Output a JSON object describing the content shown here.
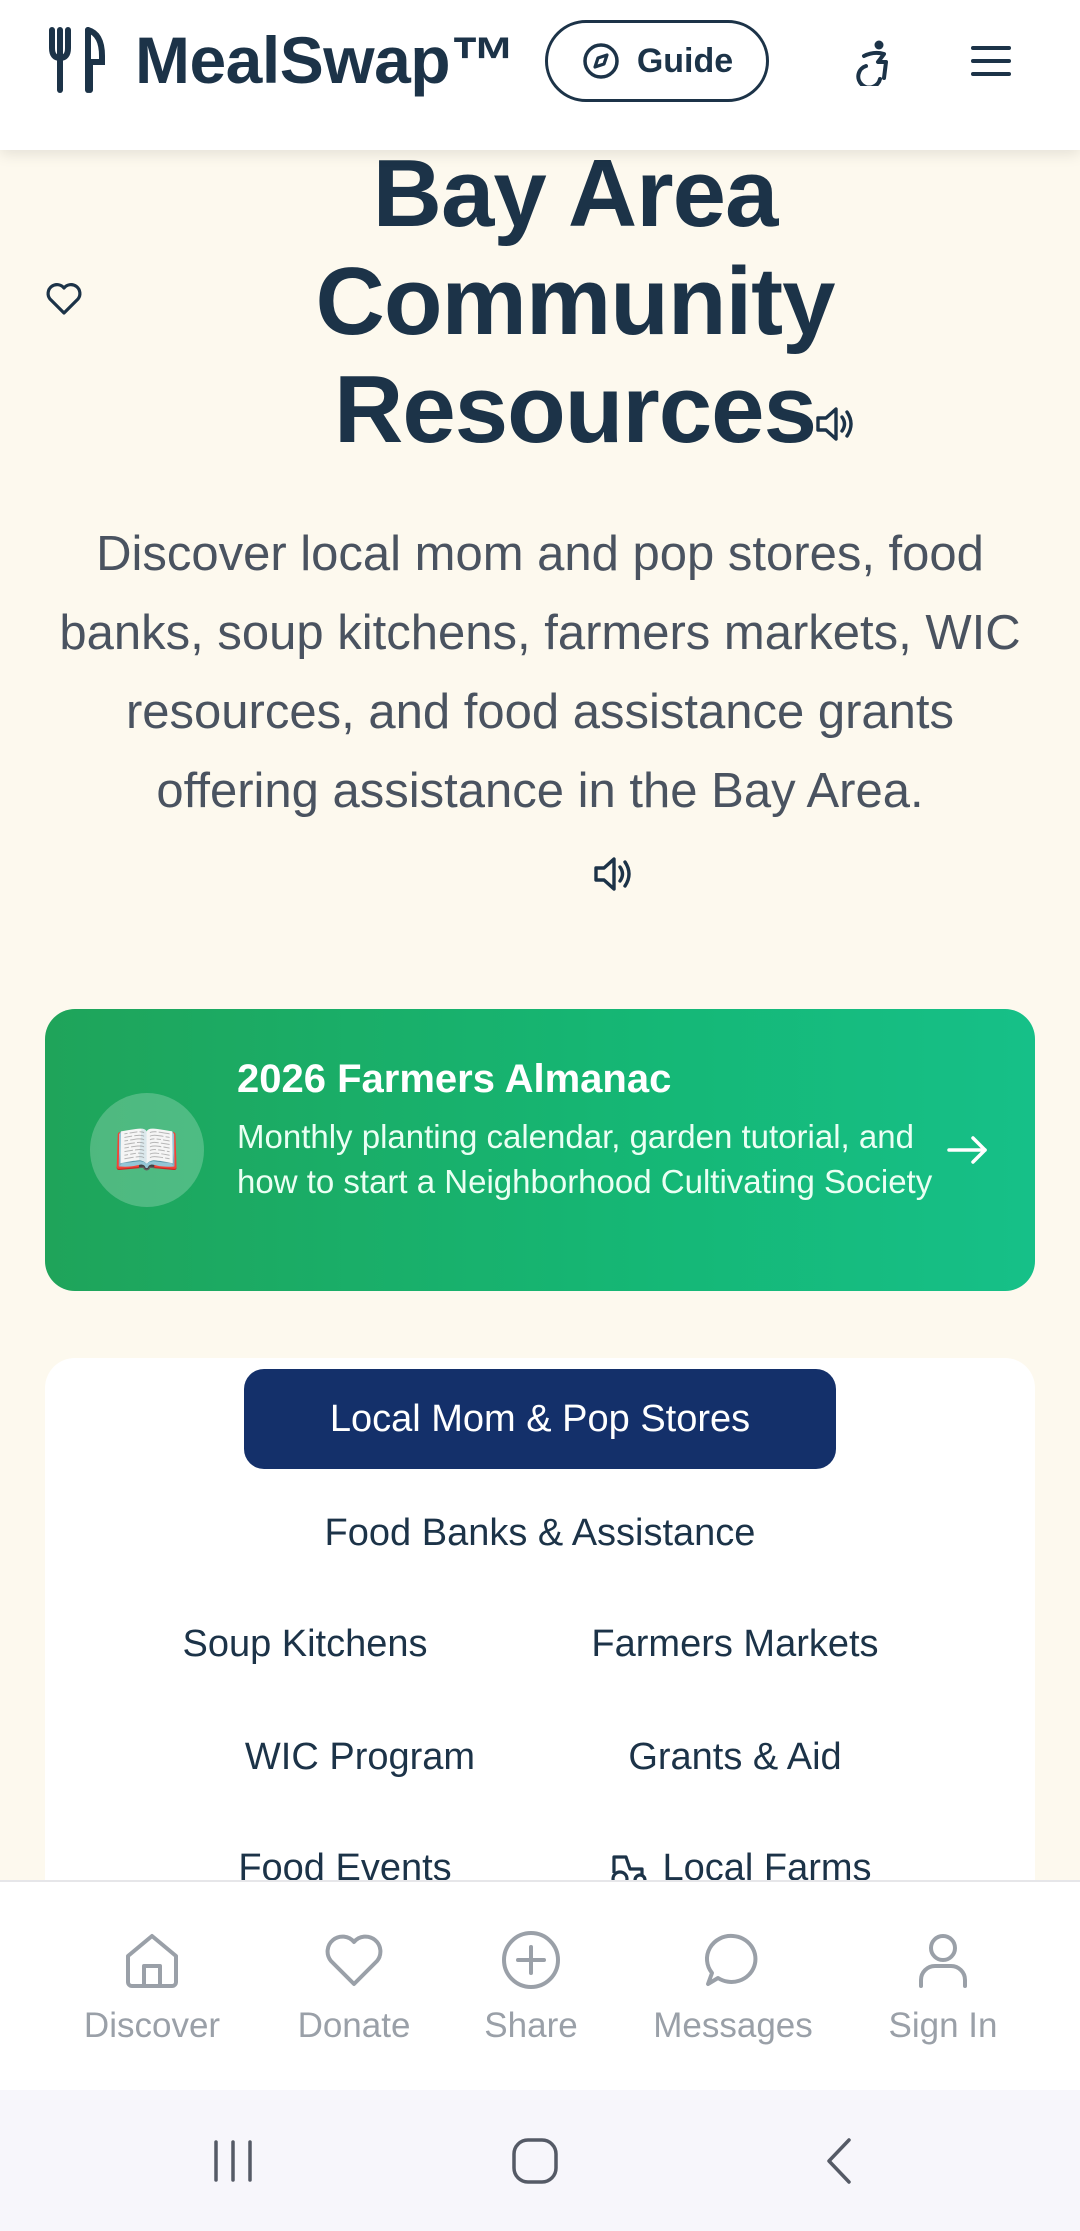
{
  "header": {
    "brand": "MealSwap™",
    "guide_label": "Guide",
    "icons": [
      "fork-knife-icon",
      "compass-icon",
      "accessibility-icon",
      "menu-icon"
    ]
  },
  "hero": {
    "title": "Bay Area Community Resources",
    "description": "Discover local mom and pop stores, food banks, soup kitchens, farmers markets, WIC resources, and food assistance grants offering assistance in the Bay Area."
  },
  "almanac": {
    "title": "2026 Farmers Almanac",
    "description": "Monthly planting calendar, garden tutorial, and how to start a Neighborhood Cultivating Society",
    "icon": "📖"
  },
  "categories": [
    {
      "label": "Local Mom & Pop Stores",
      "active": true
    },
    {
      "label": "Food Banks & Assistance",
      "active": false
    },
    {
      "label": "Soup Kitchens",
      "active": false
    },
    {
      "label": "Farmers Markets",
      "active": false
    },
    {
      "label": "WIC Program",
      "active": false
    },
    {
      "label": "Grants & Aid",
      "active": false
    },
    {
      "label": "Food Events",
      "active": false
    },
    {
      "label": "Local Farms",
      "active": false
    }
  ],
  "bottom_nav": [
    {
      "label": "Discover",
      "icon": "home-icon"
    },
    {
      "label": "Donate",
      "icon": "heart-icon"
    },
    {
      "label": "Share",
      "icon": "plus-circle-icon"
    },
    {
      "label": "Messages",
      "icon": "chat-icon"
    },
    {
      "label": "Sign In",
      "icon": "user-icon"
    }
  ],
  "colors": {
    "primary_navy": "#1c3348",
    "active_chip": "#14306a",
    "banner_green": "#1fa45a",
    "page_bg": "#fdf9ee"
  }
}
